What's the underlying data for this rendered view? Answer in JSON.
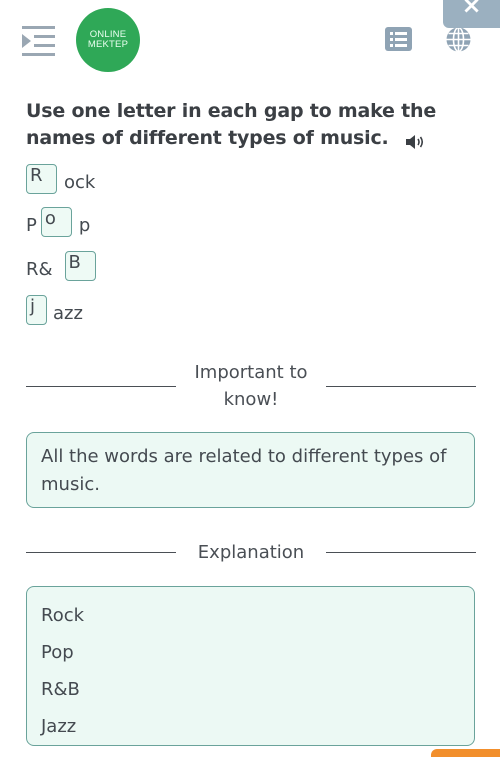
{
  "header": {
    "logo_line1": "ONLINE",
    "logo_line2": "MEKTEP",
    "brand_color": "#2fa857",
    "close_label": "×",
    "icons": [
      "menu-toggle-icon",
      "list-icon",
      "globe-icon",
      "close-icon"
    ]
  },
  "task": {
    "instruction": "Use one letter in each gap to make the names of different types of music.",
    "audio_icon": "speaker-icon"
  },
  "gaps": [
    {
      "before": "",
      "answer": "R",
      "after": "ock"
    },
    {
      "before": "P",
      "answer": "o",
      "after": "p"
    },
    {
      "before": "R&",
      "answer": "B",
      "after": ""
    },
    {
      "before": "",
      "answer": "j",
      "after": "azz"
    }
  ],
  "important": {
    "heading": "Important to know!",
    "text": "All the words are related to different types of music."
  },
  "explanation": {
    "heading": "Explanation",
    "items": [
      "Rock",
      "Pop",
      "R&B",
      "Jazz"
    ]
  },
  "colors": {
    "accent_border": "#6aa39b",
    "box_fill": "#ecf9f4",
    "action_orange": "#f28f2c"
  }
}
